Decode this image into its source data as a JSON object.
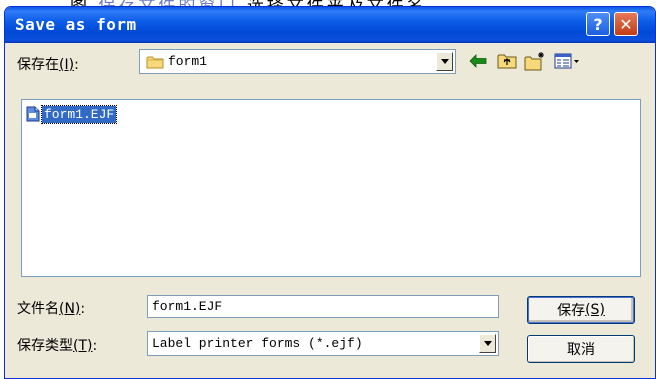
{
  "document_strip": {
    "left": "图",
    "middle": "保存文件的窗口",
    "right": "选择文件夹及文件名"
  },
  "window": {
    "title": "Save as form"
  },
  "title_buttons": {
    "help_label": "?",
    "close_label": "✕"
  },
  "save_in": {
    "label_text": "保存在",
    "label_key": "(I)",
    "label_colon": ":",
    "value": "form1"
  },
  "toolbar": {
    "icons": [
      "back-arrow-icon",
      "up-one-level-icon",
      "create-new-folder-icon",
      "view-menu-icon"
    ],
    "colors": {
      "back_arrow": "#1a8a1a",
      "folder": "#e8c14a"
    }
  },
  "file_list": {
    "items": [
      {
        "name": "form1.EJF",
        "selected": true
      }
    ]
  },
  "file_name": {
    "label_text": "文件名",
    "label_key": "(N)",
    "label_colon": ":",
    "value": "form1.EJF"
  },
  "file_type": {
    "label_text": "保存类型",
    "label_key": "(T)",
    "label_colon": ":",
    "value": "Label printer forms (*.ejf)"
  },
  "buttons": {
    "save_label_text": "保存",
    "save_label_key": "(S)",
    "cancel_label": "取消"
  },
  "colors": {
    "title_bar": "#0054e3",
    "dialog_bg": "#ece9d8",
    "selection": "#316ac5",
    "close_button": "#d74a1c"
  }
}
